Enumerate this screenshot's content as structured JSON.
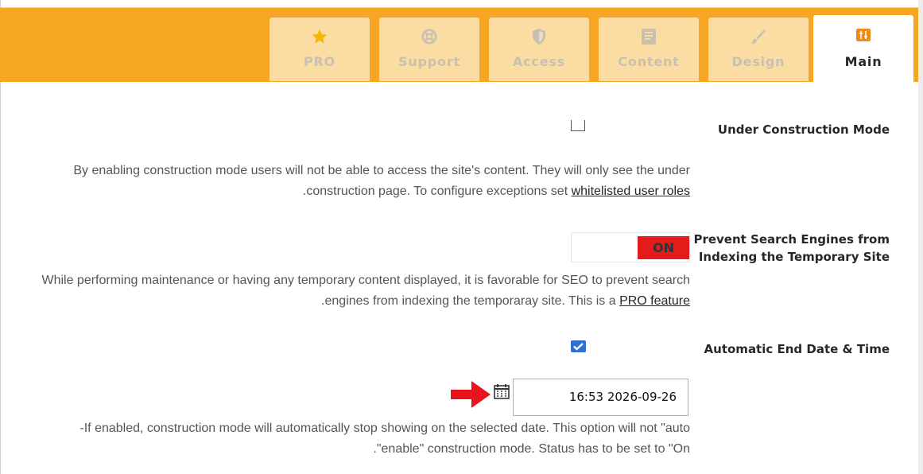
{
  "tabs": [
    {
      "label": "PRO",
      "icon": "star-icon",
      "active": false
    },
    {
      "label": "Support",
      "icon": "lifebuoy-icon",
      "active": false
    },
    {
      "label": "Access",
      "icon": "shield-icon",
      "active": false
    },
    {
      "label": "Content",
      "icon": "document-icon",
      "active": false
    },
    {
      "label": "Design",
      "icon": "brush-icon",
      "active": false
    },
    {
      "label": "Main",
      "icon": "sliders-icon",
      "active": true
    }
  ],
  "settings": {
    "construction": {
      "title": "Under Construction Mode",
      "checked": false,
      "desc_line1": "By enabling construction mode users will not be able to access the site's content. They will only see the under",
      "desc_line2_before": "construction page. To configure exceptions set ",
      "desc_link": "whitelisted user roles",
      "desc_line2_after": "."
    },
    "search_engines": {
      "title_line1": "Prevent Search Engines from",
      "title_line2": "Indexing the Temporary Site",
      "toggle_label": "ON",
      "desc_line1": "While performing maintenance or having any temporary content displayed, it is favorable for SEO to prevent search",
      "desc_line2_before": "engines from indexing the temporaray site. This is a ",
      "desc_link": "PRO feature",
      "desc_line2_after": "."
    },
    "end_date": {
      "title": "Automatic End Date & Time",
      "checked": true,
      "date_value": "16:53 2026-09-26",
      "desc_line1": "If enabled, construction mode will automatically stop showing on the selected date. This option will not \"auto-",
      "desc_line2": "enable\" construction mode. Status has to be set to \"On\"."
    }
  },
  "colors": {
    "topbar": "#f6a623",
    "tab_inactive": "#fbdca3",
    "toggle_on": "#e51b1b",
    "checkbox": "#2f6fd0",
    "arrow": "#e8141c"
  }
}
